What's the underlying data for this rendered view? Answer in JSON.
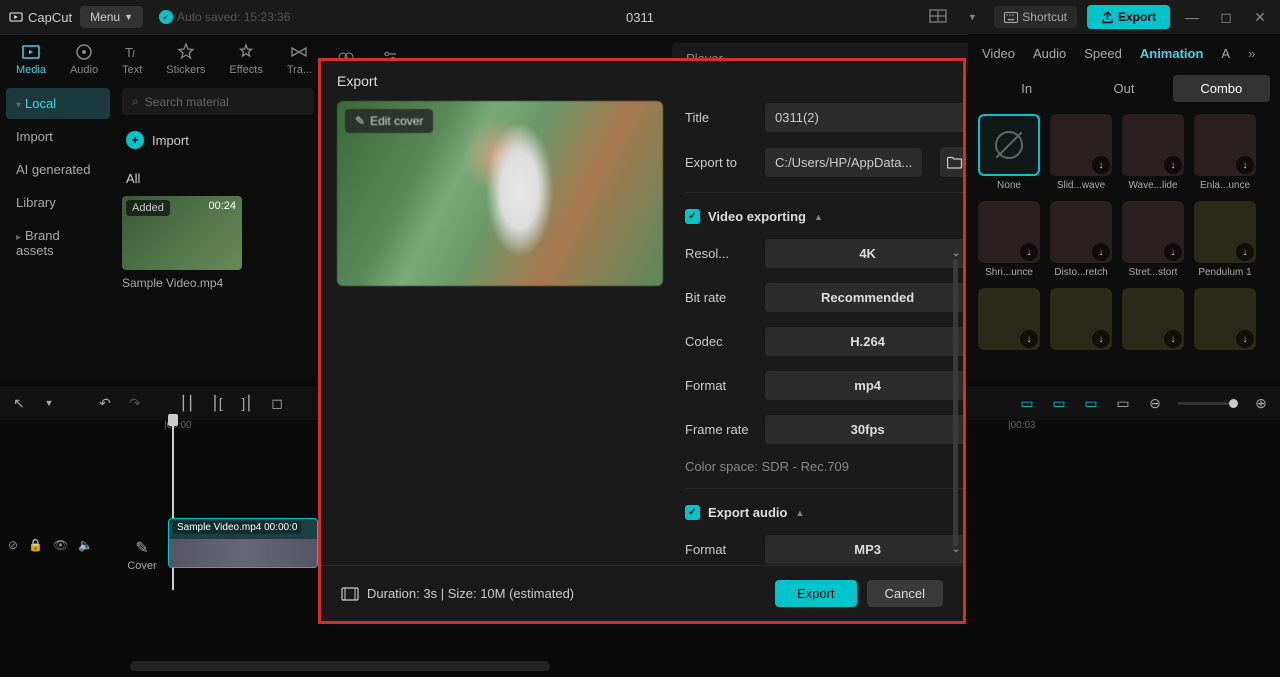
{
  "app": {
    "name": "CapCut",
    "menu": "Menu",
    "autosave": "Auto saved: 15:23:36",
    "project": "0311",
    "shortcut": "Shortcut",
    "export": "Export"
  },
  "toolbar": {
    "media": "Media",
    "audio": "Audio",
    "text": "Text",
    "stickers": "Stickers",
    "effects": "Effects",
    "transitions": "Tra..."
  },
  "player": {
    "label": "Player"
  },
  "sidebar": {
    "local": "Local",
    "import": "Import",
    "ai": "AI generated",
    "library": "Library",
    "brand": "Brand assets"
  },
  "media": {
    "search": "Search material",
    "import_btn": "Import",
    "all": "All",
    "clip_added": "Added",
    "clip_dur": "00:24",
    "clip_name": "Sample Video.mp4"
  },
  "right": {
    "tabs": {
      "video": "Video",
      "audio": "Audio",
      "speed": "Speed",
      "animation": "Animation",
      "more": "A"
    },
    "sub": {
      "in": "In",
      "out": "Out",
      "combo": "Combo"
    },
    "items": [
      "None",
      "Slid...wave",
      "Wave...lide",
      "Enla...unce",
      "Shri...unce",
      "Disto...retch",
      "Stret...stort",
      "Pendulum 1",
      "",
      "",
      "",
      ""
    ]
  },
  "timeline": {
    "t0": "|00:00",
    "t3": "|00:03",
    "track": "Sample Video.mp4   00:00:0",
    "cover": "Cover"
  },
  "modal": {
    "title": "Export",
    "edit_cover": "Edit cover",
    "title_label": "Title",
    "title_value": "0311(2)",
    "exportto_label": "Export to",
    "exportto_value": "C:/Users/HP/AppData...",
    "video_section": "Video exporting",
    "res_label": "Resol...",
    "res_value": "4K",
    "bitrate_label": "Bit rate",
    "bitrate_value": "Recommended",
    "codec_label": "Codec",
    "codec_value": "H.264",
    "format_label": "Format",
    "format_value": "mp4",
    "fps_label": "Frame rate",
    "fps_value": "30fps",
    "colorspace": "Color space: SDR - Rec.709",
    "audio_section": "Export audio",
    "audio_format_label": "Format",
    "audio_format_value": "MP3",
    "duration": "Duration: 3s | Size: 10M (estimated)",
    "export_btn": "Export",
    "cancel_btn": "Cancel"
  }
}
